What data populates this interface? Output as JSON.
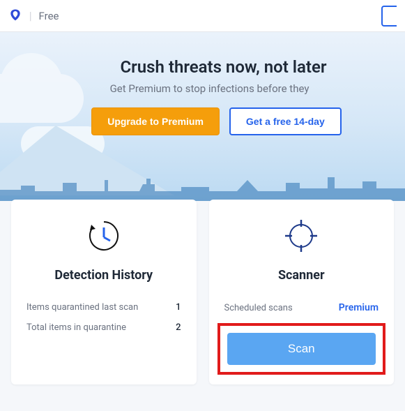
{
  "header": {
    "tier": "Free"
  },
  "hero": {
    "title": "Crush threats now, not later",
    "subtitle": "Get Premium to stop infections before they",
    "upgrade_label": "Upgrade to Premium",
    "trial_label": "Get a free 14-day"
  },
  "history_card": {
    "title": "Detection History",
    "row1_label": "Items quarantined last scan",
    "row1_value": "1",
    "row2_label": "Total items in quarantine",
    "row2_value": "2"
  },
  "scanner_card": {
    "title": "Scanner",
    "scheduled_label": "Scheduled scans",
    "scheduled_value": "Premium",
    "scan_label": "Scan"
  },
  "colors": {
    "accent_blue": "#2563eb",
    "accent_orange": "#f59e0b",
    "scan_blue": "#5aa6f2",
    "highlight_red": "#e11b1b"
  }
}
